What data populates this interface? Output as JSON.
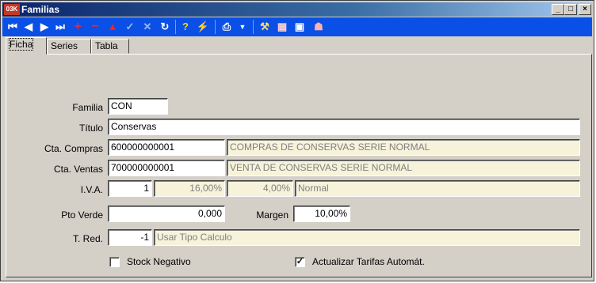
{
  "window": {
    "app_badge": "03K",
    "title": "Familias"
  },
  "toolbar": {
    "icons": [
      "first-record-icon",
      "prev-record-icon",
      "next-record-icon",
      "last-record-icon",
      "add-icon",
      "delete-icon",
      "edit-icon",
      "confirm-icon",
      "cancel-icon",
      "refresh-icon",
      "help-icon",
      "lightning-icon",
      "print-icon",
      "print-dropdown-icon",
      "tools-icon",
      "calculator-icon",
      "image-icon",
      "users-icon"
    ]
  },
  "tabs": {
    "ficha": "Ficha",
    "series": "Series",
    "tabla": "Tabla",
    "active": "Ficha"
  },
  "form": {
    "familia_label": "Familia",
    "familia_value": "CON",
    "titulo_label": "Título",
    "titulo_value": "Conservas",
    "cta_compras_label": "Cta. Compras",
    "cta_compras_value": "600000000001",
    "cta_compras_desc": "COMPRAS DE CONSERVAS SERIE NORMAL",
    "cta_ventas_label": "Cta. Ventas",
    "cta_ventas_value": "700000000001",
    "cta_ventas_desc": "VENTA DE CONSERVAS SERIE NORMAL",
    "iva_label": "I.V.A.",
    "iva_code": "1",
    "iva_pct": "16,00%",
    "iva_rec": "4,00%",
    "iva_desc": "Normal",
    "pto_verde_label": "Pto Verde",
    "pto_verde_value": "0,000",
    "margen_label": "Margen",
    "margen_value": "10,00%",
    "t_red_label": "T. Red.",
    "t_red_value": "-1",
    "t_red_desc": "Usar Tipo Calculo",
    "stock_negativo_label": "Stock Negativo",
    "stock_negativo_checked": false,
    "actualizar_label": "Actualizar Tarifas Automát.",
    "actualizar_checked": true
  }
}
